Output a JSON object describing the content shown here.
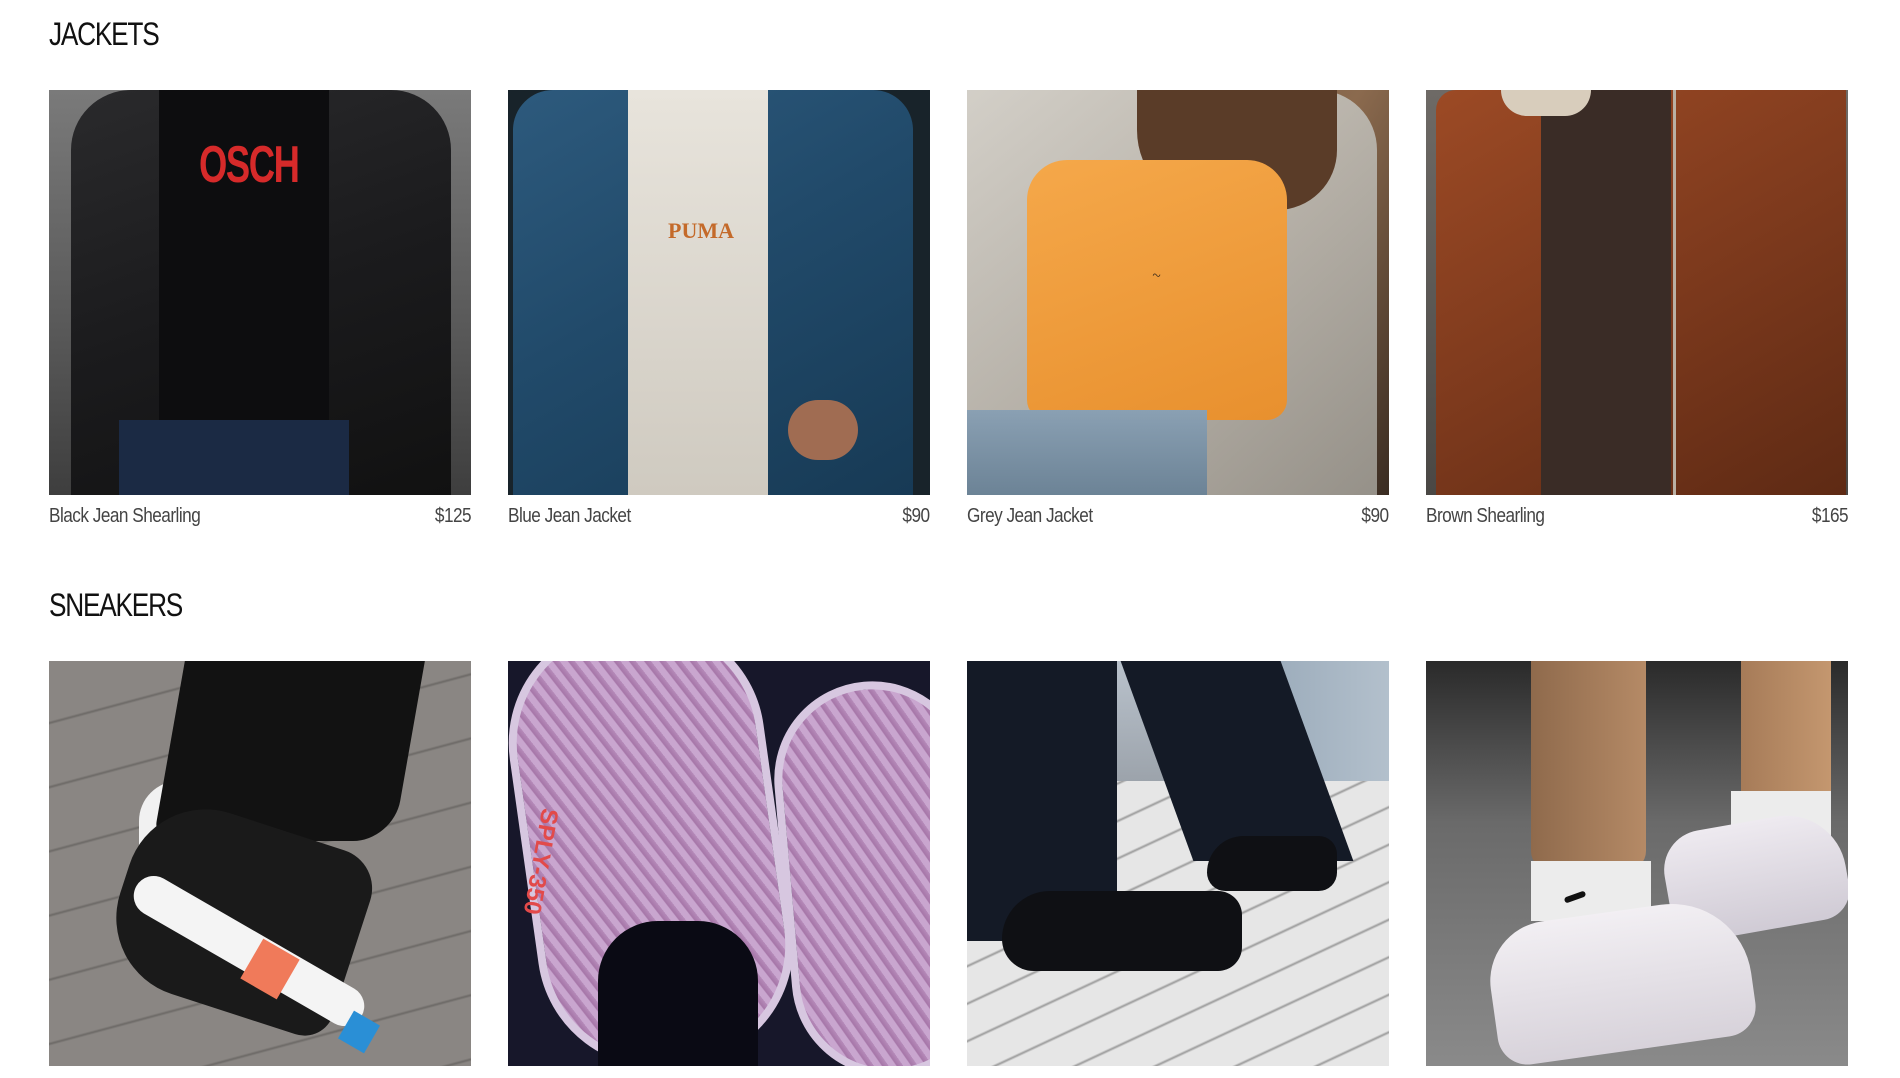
{
  "sections": [
    {
      "title": "JACKETS",
      "products": [
        {
          "name": "Black Jean Shearling",
          "price": "$125",
          "image": "black-jacket-image",
          "logo_text": "OSCH"
        },
        {
          "name": "Blue Jean Jacket",
          "price": "$90",
          "image": "blue-jacket-image",
          "logo_text": "PUMA"
        },
        {
          "name": "Grey Jean Jacket",
          "price": "$90",
          "image": "grey-jacket-image"
        },
        {
          "name": "Brown Shearling",
          "price": "$165",
          "image": "brown-jacket-image"
        }
      ]
    },
    {
      "title": "SNEAKERS",
      "products": [
        {
          "image": "nmd-sneaker-image"
        },
        {
          "image": "yeezy-sneaker-image",
          "logo_text": "SPLY-350"
        },
        {
          "image": "converse-sneaker-image"
        },
        {
          "image": "airforce-sneaker-image"
        }
      ]
    }
  ],
  "colors": {
    "background": "#ffffff",
    "title": "#111111",
    "caption": "#444444"
  }
}
